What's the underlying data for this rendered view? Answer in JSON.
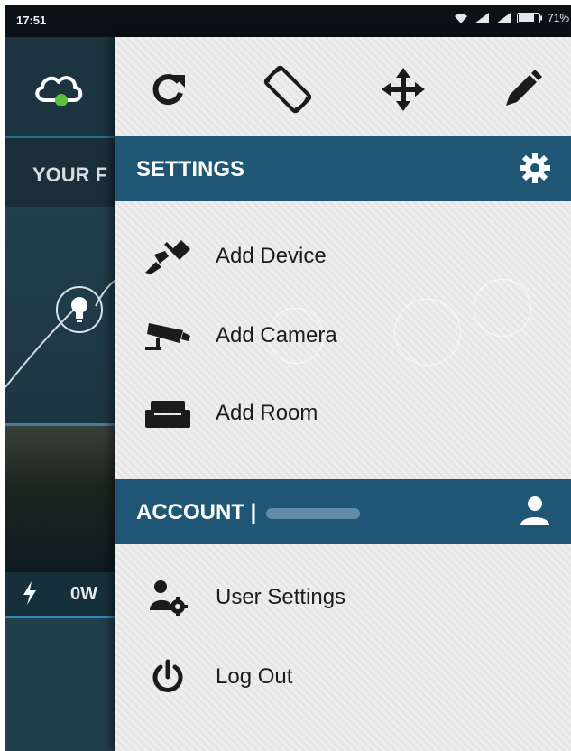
{
  "status_bar": {
    "time": "17:51",
    "battery": "71%"
  },
  "background": {
    "section_label": "YOUR F",
    "power_value": "0W"
  },
  "drawer": {
    "toolbar_icons": [
      "refresh-icon",
      "rotate-screen-icon",
      "move-icon",
      "edit-icon"
    ],
    "settings": {
      "title": "SETTINGS",
      "items": [
        {
          "label": "Add Device",
          "icon": "plug-icon"
        },
        {
          "label": "Add Camera",
          "icon": "camera-icon"
        },
        {
          "label": "Add Room",
          "icon": "sofa-icon"
        }
      ]
    },
    "account": {
      "title": "ACCOUNT |",
      "items": [
        {
          "label": "User Settings",
          "icon": "user-settings-icon"
        },
        {
          "label": "Log Out",
          "icon": "power-icon"
        }
      ]
    }
  },
  "colors": {
    "accent": "#1f5676",
    "app_background": "#213e4b",
    "status_online": "#5fbf3a"
  }
}
